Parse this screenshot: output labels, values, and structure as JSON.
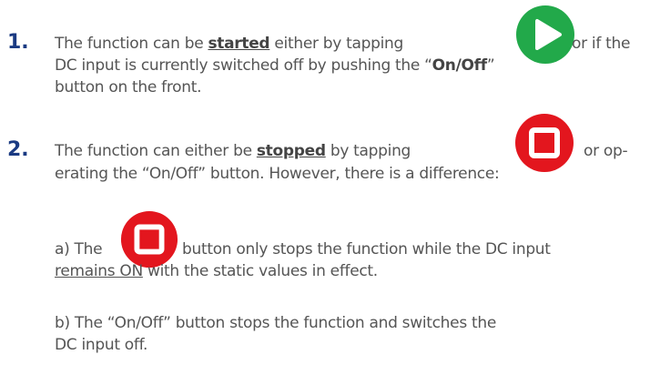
{
  "step1": {
    "number": "1.",
    "line1_pre": "The function can be ",
    "line1_emph": "started",
    "line1_mid": " either by tapping",
    "line1_post": "or if the",
    "line2_pre": "DC input is currently switched off by pushing the “",
    "line2_bold": "On/Off",
    "line2_post": "”",
    "line3": "button on the front.",
    "icon": "play-icon",
    "icon_color": "#22a94a"
  },
  "step2": {
    "number": "2.",
    "line1_pre": "The function can either be ",
    "line1_emph": "stopped",
    "line1_mid": " by tapping",
    "line1_post": "or op-",
    "line2": "erating the “On/Off” button. However, there is a difference:",
    "icon": "stop-icon",
    "icon_color": "#e3161e"
  },
  "note_a": {
    "pre": "a) The",
    "post": "button only stops the function while the DC input",
    "line2_ul": "remains ON",
    "line2_post": " with the static values in effect.",
    "icon": "stop-icon",
    "icon_color": "#e3161e"
  },
  "note_b": {
    "line1": "b) The “On/Off” button stops the function and switches the",
    "line2": "DC input off."
  }
}
